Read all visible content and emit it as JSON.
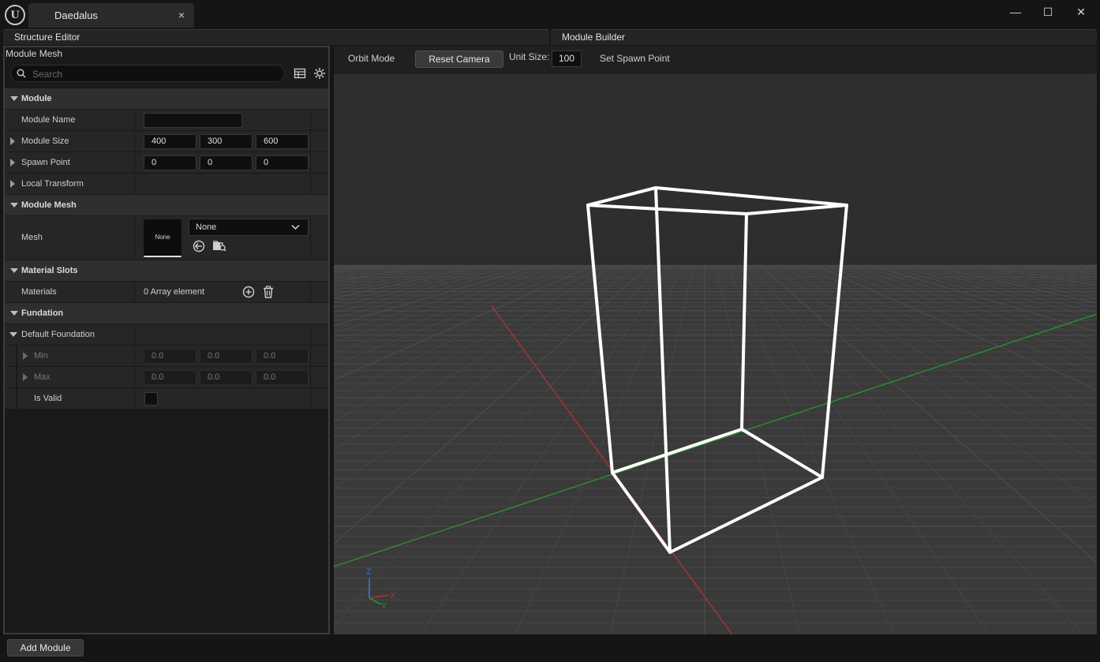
{
  "window": {
    "app_logo": "U",
    "tab_title": "Daedalus",
    "tab_close_glyph": "×",
    "minimize_glyph": "—",
    "maximize_glyph": "☐",
    "close_glyph": "✕"
  },
  "panels": {
    "structure_editor": "Structure Editor",
    "module_builder": "Module Builder"
  },
  "details": {
    "title": "Module Mesh",
    "search_placeholder": "Search",
    "sections": {
      "module": {
        "label": "Module",
        "module_name_label": "Module Name",
        "module_name_value": "",
        "module_size_label": "Module Size",
        "module_size": [
          "400",
          "300",
          "600"
        ],
        "spawn_point_label": "Spawn Point",
        "spawn_point": [
          "0",
          "0",
          "0"
        ],
        "local_transform_label": "Local Transform"
      },
      "module_mesh": {
        "label": "Module Mesh",
        "mesh_label": "Mesh",
        "thumbnail_text": "None",
        "dropdown_value": "None"
      },
      "material_slots": {
        "label": "Material Slots",
        "materials_label": "Materials",
        "materials_value": "0 Array element"
      },
      "fundation": {
        "label": "Fundation",
        "default_foundation_label": "Default Foundation",
        "min_label": "Min",
        "min": [
          "0.0",
          "0.0",
          "0.0"
        ],
        "max_label": "Max",
        "max": [
          "0.0",
          "0.0",
          "0.0"
        ],
        "is_valid_label": "Is Valid"
      }
    }
  },
  "viewport": {
    "orbit_mode": "Orbit Mode",
    "reset_camera": "Reset Camera",
    "unit_size_label": "Unit Size:",
    "unit_size_value": "100",
    "set_spawn_point": "Set Spawn Point",
    "axis_z": "Z",
    "axis_x": "X",
    "axis_y": "Y",
    "colors": {
      "x_axis": "#a83232",
      "y_axis": "#2e8a2e",
      "z_axis": "#3c6fd0",
      "wireframe": "#ffffff"
    }
  },
  "footer": {
    "add_module": "Add Module"
  }
}
